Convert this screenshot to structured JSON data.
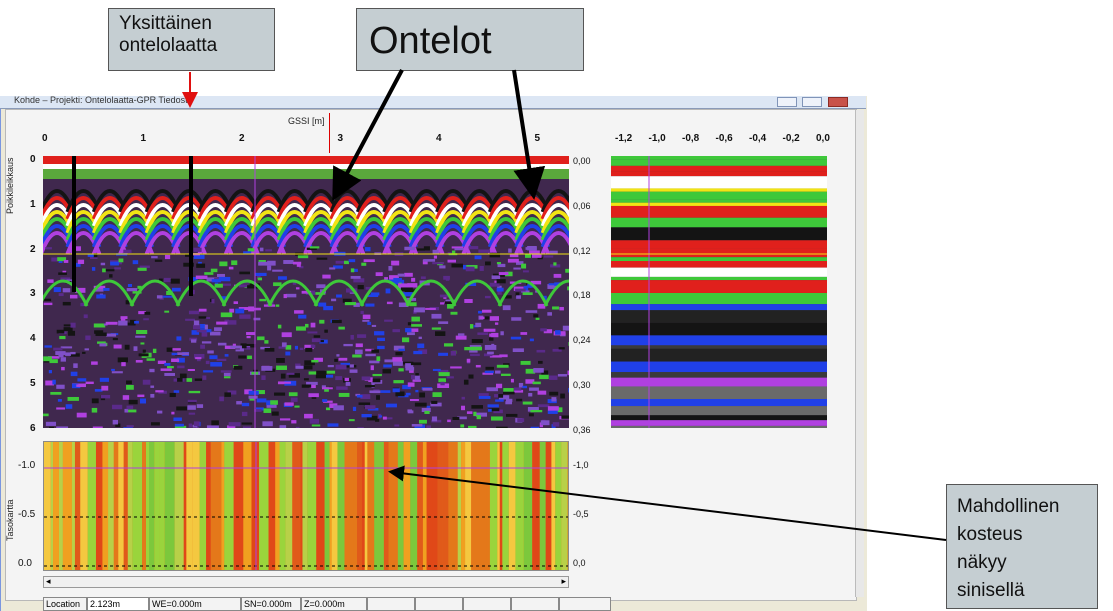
{
  "window": {
    "title": "Kohde – Projekti: Ontelolaatta-GPR Tiedosto",
    "cursor_label": "GSSI [m]"
  },
  "callouts": {
    "single_slab": [
      "Yksittäinen",
      "ontelolaatta"
    ],
    "voids": "Ontelot",
    "moisture": [
      "Mahdollinen",
      "kosteus",
      "näkyy",
      "sinisellä"
    ]
  },
  "axes": {
    "main_x_ticks": [
      "0",
      "1",
      "2",
      "3",
      "4",
      "5"
    ],
    "main_y_label": "Poikkileikkaus",
    "main_y_ticks": [
      "0",
      "1",
      "2",
      "3",
      "4",
      "5",
      "6"
    ],
    "time_ticks": [
      "0,00",
      "0,06",
      "0,12",
      "0,18",
      "0,24",
      "0,30",
      "0,36"
    ],
    "side_x_ticks": [
      "-1,2",
      "-1,0",
      "-0,8",
      "-0,6",
      "-0,4",
      "-0,2",
      "0,0"
    ],
    "plan_y_label": "Tasokartta",
    "plan_left_ticks": [
      "-1.0",
      "-0.5",
      "0.0"
    ],
    "plan_right_ticks": [
      "-1,0",
      "-0,5",
      "0,0"
    ]
  },
  "status": {
    "location": "Location",
    "location_value": "2.123m",
    "we": "WE=0.000m",
    "sn": "SN=0.000m",
    "z": "Z=0.000m"
  },
  "colors": {
    "callout_bg": "#c5ced2",
    "red": "#e0201c",
    "yellow": "#f2e414",
    "green": "#3ec83a",
    "blue": "#2040e8",
    "magenta": "#b040e0",
    "purple": "#5a2a8a",
    "black": "#141414",
    "white": "#ffffff",
    "orange": "#e4781a"
  }
}
